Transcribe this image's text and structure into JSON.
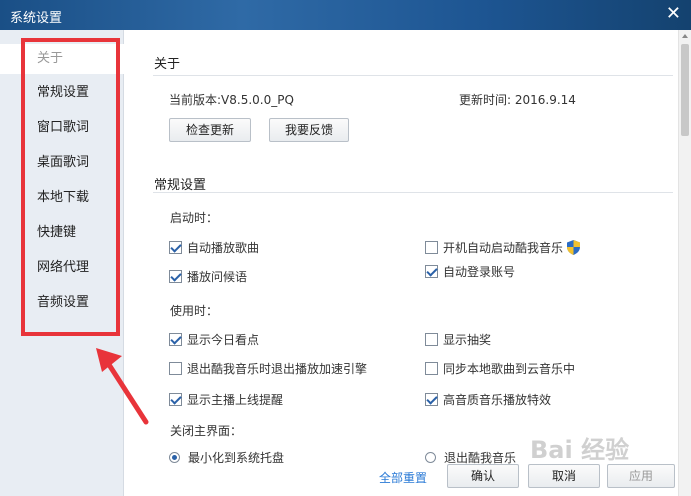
{
  "window": {
    "title": "系统设置",
    "close_glyph": "✕"
  },
  "sidebar": {
    "items": [
      {
        "label": "关于"
      },
      {
        "label": "常规设置"
      },
      {
        "label": "窗口歌词"
      },
      {
        "label": "桌面歌词"
      },
      {
        "label": "本地下载"
      },
      {
        "label": "快捷键"
      },
      {
        "label": "网络代理"
      },
      {
        "label": "音频设置"
      }
    ]
  },
  "about": {
    "title": "关于",
    "version": "当前版本:V8.5.0.0_PQ",
    "update_time": "更新时间: 2016.9.14",
    "check_update": "检查更新",
    "feedback": "我要反馈"
  },
  "general": {
    "title": "常规设置",
    "on_start": "启动时：",
    "auto_play": {
      "label": "自动播放歌曲",
      "checked": true
    },
    "boot_start": {
      "label": "开机自动启动酷我音乐",
      "checked": false
    },
    "greeting": {
      "label": "播放问候语",
      "checked": true
    },
    "auto_login": {
      "label": "自动登录账号",
      "checked": true
    },
    "in_use": "使用时：",
    "today": {
      "label": "显示今日看点",
      "checked": true
    },
    "lottery": {
      "label": "显示抽奖",
      "checked": false
    },
    "exit_accel": {
      "label": "退出酷我音乐时退出播放加速引擎",
      "checked": false
    },
    "sync_cloud": {
      "label": "同步本地歌曲到云音乐中",
      "checked": false
    },
    "anchor_remind": {
      "label": "显示主播上线提醒",
      "checked": true
    },
    "hq_effect": {
      "label": "高音质音乐播放特效",
      "checked": true
    },
    "close_main": "关闭主界面：",
    "minimize_tray": {
      "label": "最小化到系统托盘",
      "selected": true
    },
    "exit_app": {
      "label": "退出酷我音乐",
      "selected": false
    }
  },
  "footer": {
    "reset_all": "全部重置",
    "confirm": "确认",
    "cancel": "取消",
    "apply": "应用"
  },
  "watermark": "Bai 经验",
  "colors": {
    "titlebar": "#1f5a96",
    "highlight_box": "#e8343a",
    "link": "#2a7ad6"
  }
}
